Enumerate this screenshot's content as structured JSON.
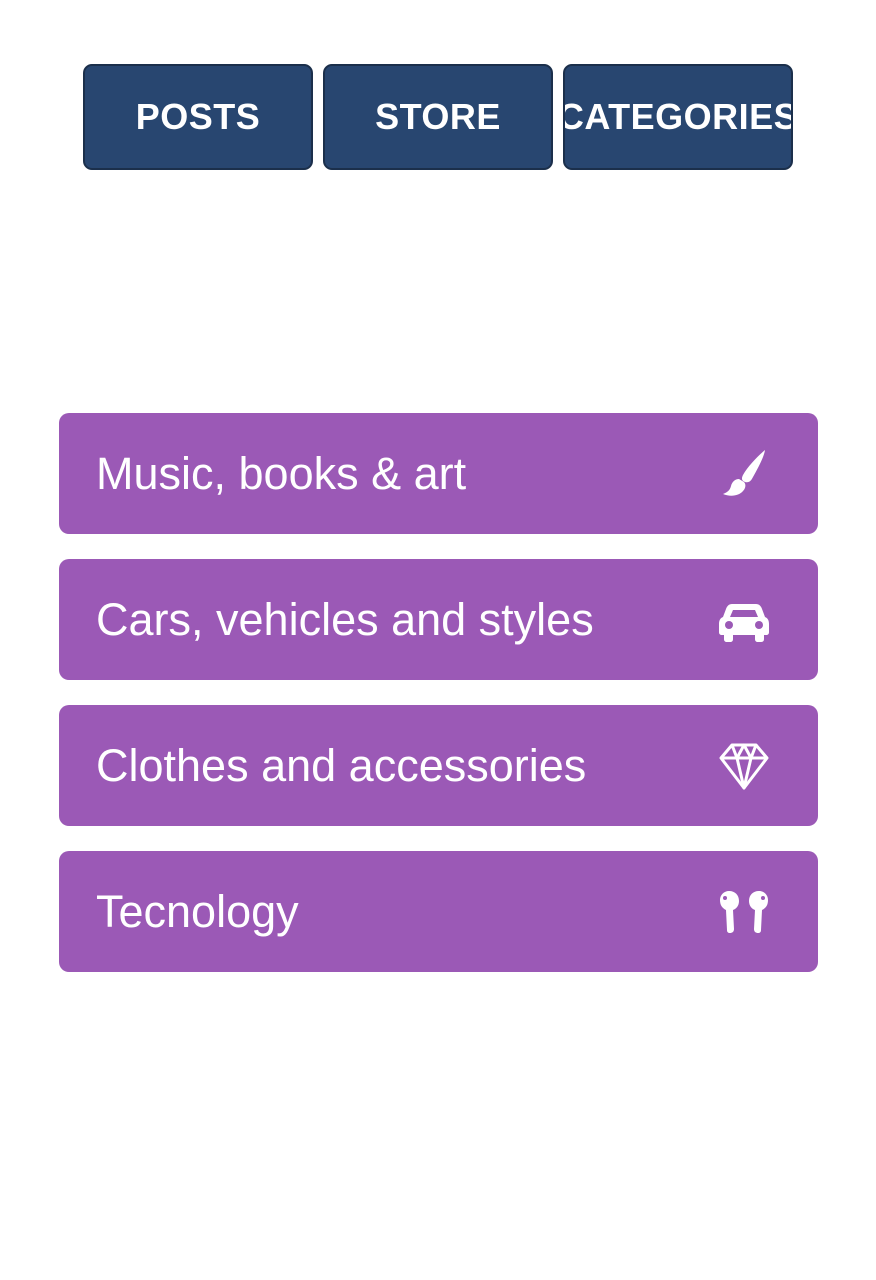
{
  "nav": {
    "buttons": [
      {
        "label": "POSTS"
      },
      {
        "label": "STORE"
      },
      {
        "label": "CATEGORIES"
      }
    ]
  },
  "categories": [
    {
      "label": "Music, books & art",
      "icon": "paintbrush-icon"
    },
    {
      "label": "Cars, vehicles and styles",
      "icon": "car-icon"
    },
    {
      "label": "Clothes and accessories",
      "icon": "diamond-icon"
    },
    {
      "label": "Tecnology",
      "icon": "earbuds-icon"
    }
  ],
  "colors": {
    "nav_button": "#284670",
    "category_card": "#9b59b6",
    "text": "#ffffff"
  }
}
